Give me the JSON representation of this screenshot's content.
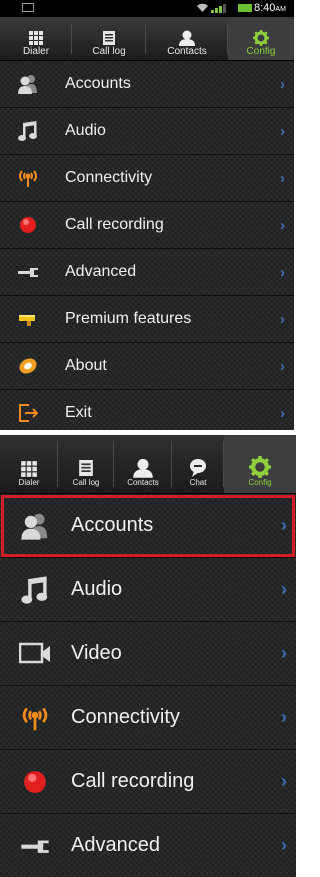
{
  "statusbar": {
    "time": "8:40",
    "ampm": "AM",
    "wifi_icon": "wifi-icon",
    "signal_icon": "signal-bars-icon",
    "battery_icon": "battery-icon"
  },
  "top": {
    "tabs": [
      {
        "label": "Dialer",
        "icon": "keypad-icon"
      },
      {
        "label": "Call log",
        "icon": "call-log-icon"
      },
      {
        "label": "Contacts",
        "icon": "contact-person-icon"
      },
      {
        "label": "Config",
        "icon": "gear-icon",
        "active": true
      }
    ],
    "menu": [
      {
        "label": "Accounts",
        "icon": "accounts-icon"
      },
      {
        "label": "Audio",
        "icon": "music-note-icon"
      },
      {
        "label": "Connectivity",
        "icon": "antenna-icon"
      },
      {
        "label": "Call recording",
        "icon": "record-dot-icon"
      },
      {
        "label": "Advanced",
        "icon": "wrench-icon"
      },
      {
        "label": "Premium features",
        "icon": "premium-flag-icon"
      },
      {
        "label": "About",
        "icon": "about-icon"
      },
      {
        "label": "Exit",
        "icon": "exit-icon"
      }
    ]
  },
  "bottom": {
    "tabs": [
      {
        "label": "Dialer",
        "icon": "keypad-icon"
      },
      {
        "label": "Call log",
        "icon": "call-log-icon"
      },
      {
        "label": "Contacts",
        "icon": "contact-person-icon"
      },
      {
        "label": "Chat",
        "icon": "chat-bubble-icon"
      },
      {
        "label": "Config",
        "icon": "gear-icon",
        "active": true
      }
    ],
    "menu": [
      {
        "label": "Accounts",
        "icon": "accounts-icon",
        "highlighted": true
      },
      {
        "label": "Audio",
        "icon": "music-note-icon"
      },
      {
        "label": "Video",
        "icon": "video-camera-icon"
      },
      {
        "label": "Connectivity",
        "icon": "antenna-icon"
      },
      {
        "label": "Call recording",
        "icon": "record-dot-icon"
      },
      {
        "label": "Advanced",
        "icon": "wrench-icon"
      }
    ]
  },
  "chevron": "›",
  "colors": {
    "accent_green": "#8fd13b",
    "chevron_blue": "#3f6fb5",
    "highlight_red": "#d21f27",
    "record_red": "#e02020",
    "antenna_orange": "#f08a1c",
    "premium_yellow": "#f2c21b"
  }
}
